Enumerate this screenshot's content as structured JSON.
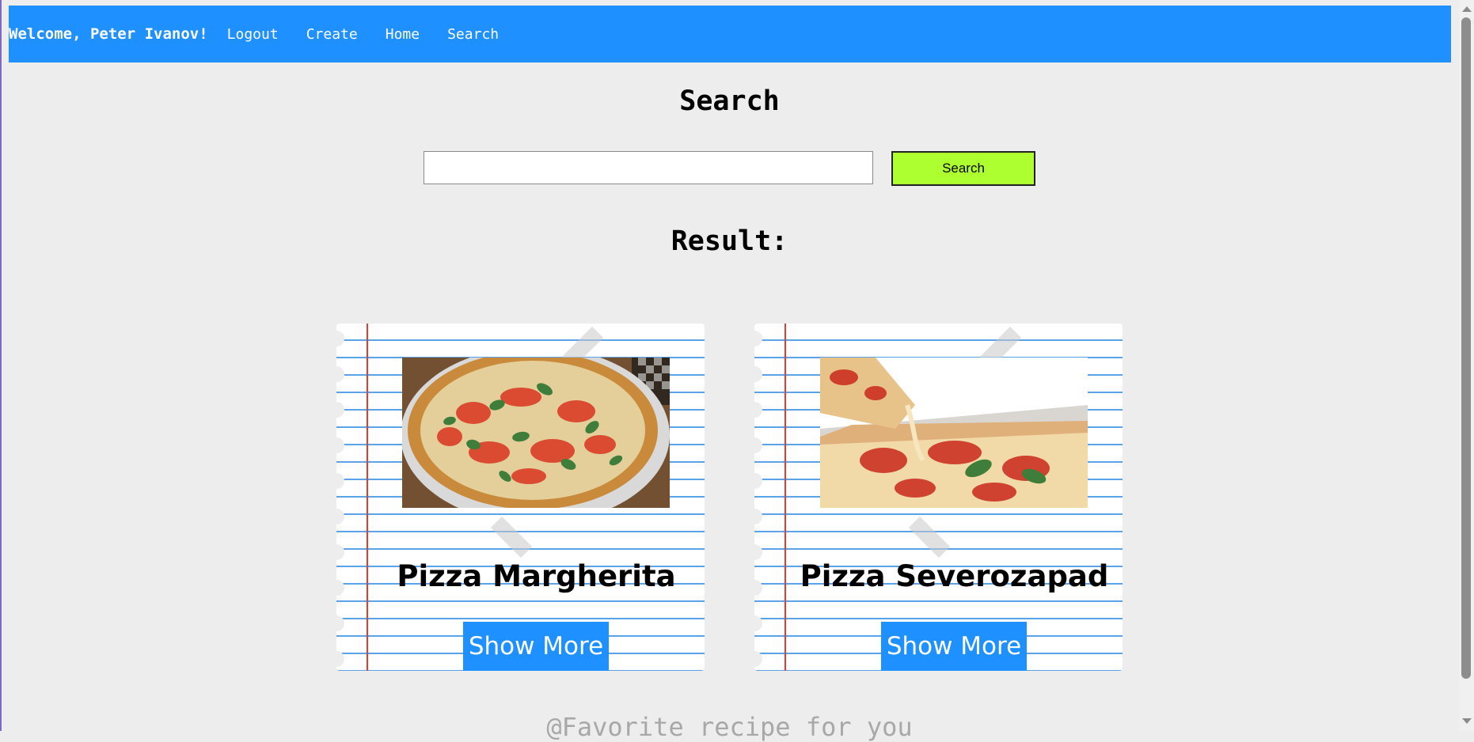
{
  "nav": {
    "welcome": "Welcome, Peter Ivanov!",
    "links": [
      "Logout",
      "Create",
      "Home",
      "Search"
    ]
  },
  "search": {
    "title": "Search",
    "input_value": "",
    "input_placeholder": "",
    "button_label": "Search"
  },
  "results": {
    "title": "Result:",
    "cards": [
      {
        "name": "Pizza Margherita",
        "button_label": "Show More"
      },
      {
        "name": "Pizza Severozapad",
        "button_label": "Show More"
      }
    ]
  },
  "footer": {
    "text": "@Favorite recipe for you"
  },
  "colors": {
    "navbar": "#1e90ff",
    "search_button": "#adff2f",
    "show_more": "#1e90ff",
    "background": "#ededed"
  }
}
